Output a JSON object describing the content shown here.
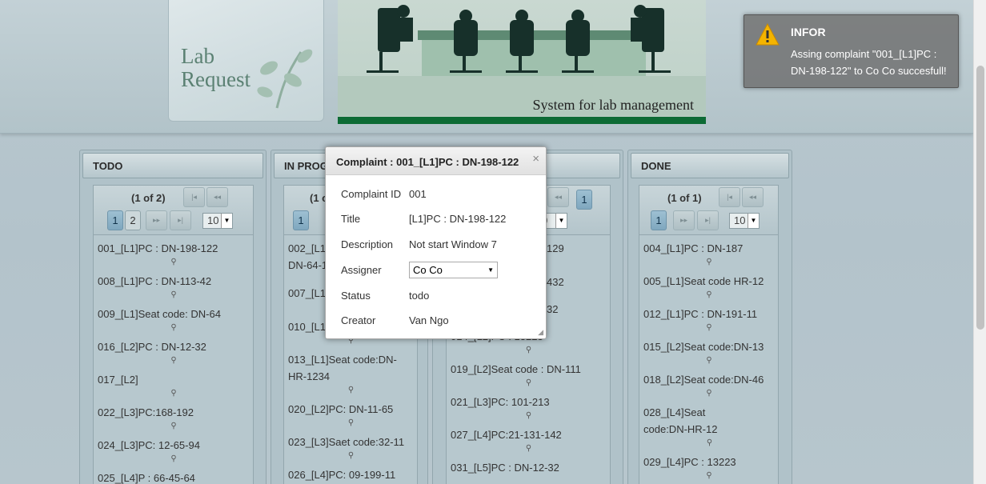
{
  "header": {
    "logo": {
      "line1": "Lab",
      "line2": "Request"
    },
    "banner_caption": "System for lab management"
  },
  "columns": {
    "todo": {
      "title": "TODO",
      "pager_info": "(1 of 2)",
      "pages": [
        "1",
        "2"
      ],
      "rows_per_page": "10",
      "items": [
        "001_[L1]PC : DN-198-122",
        "008_[L1]PC : DN-113-42",
        "009_[L1]Seat code: DN-64",
        "016_[L2]PC : DN-12-32",
        "017_[L2]",
        "022_[L3]PC:168-192",
        "024_[L3]PC: 12-65-94",
        "025_[L4]P : 66-45-64"
      ]
    },
    "inprogress": {
      "title": "IN PROG",
      "pager_info": "(1 o",
      "pages": [
        "1"
      ],
      "items": [
        "002_[L1]",
        "DN-64-1",
        "007_[L1]",
        "010_[L1]",
        "013_[L1]Seat code:DN-HR-1234",
        "020_[L2]PC: DN-11-65",
        "023_[L3]Saet code:32-11",
        "026_[L4]PC: 09-199-11"
      ]
    },
    "third": {
      "pages": [
        "1"
      ],
      "rows_per_page": "0",
      "items": [
        "129",
        "432",
        "32",
        "014_[L2]PC : 13223",
        "019_[L2]Seat code : DN-111",
        "021_[L3]PC: 101-213",
        "027_[L4]PC:21-131-142",
        "031_[L5]PC : DN-12-32"
      ]
    },
    "done": {
      "title": "DONE",
      "pager_info": "(1 of 1)",
      "pages": [
        "1"
      ],
      "rows_per_page": "10",
      "items": [
        "004_[L1]PC : DN-187",
        "005_[L1]Seat code HR-12",
        "012_[L1]PC : DN-191-11",
        "015_[L2]Seat code:DN-13",
        "018_[L2]Seat code:DN-46",
        "028_[L4]Seat code:DN-HR-12",
        "029_[L4]PC : 13223"
      ]
    }
  },
  "dialog": {
    "title": "Complaint : 001_[L1]PC : DN-198-122",
    "close_glyph": "×",
    "labels": {
      "id": "Complaint ID",
      "title": "Title",
      "description": "Description",
      "assigner": "Assigner",
      "status": "Status",
      "creator": "Creator"
    },
    "values": {
      "id": "001",
      "title": "[L1]PC : DN-198-122",
      "description": "Not start Window 7",
      "assigner": "Co Co",
      "status": "todo",
      "creator": "Van Ngo"
    }
  },
  "toast": {
    "title": "INFOR",
    "message": "Assing complaint \"001_[L1]PC : DN-198-122\" to Co Co succesfull!",
    "icon": "warning-icon"
  },
  "icons": {
    "search": "⚲",
    "first": "|◂",
    "prev": "◂◂",
    "next": "▸▸",
    "last": "▸|",
    "dropdown": "▼"
  }
}
